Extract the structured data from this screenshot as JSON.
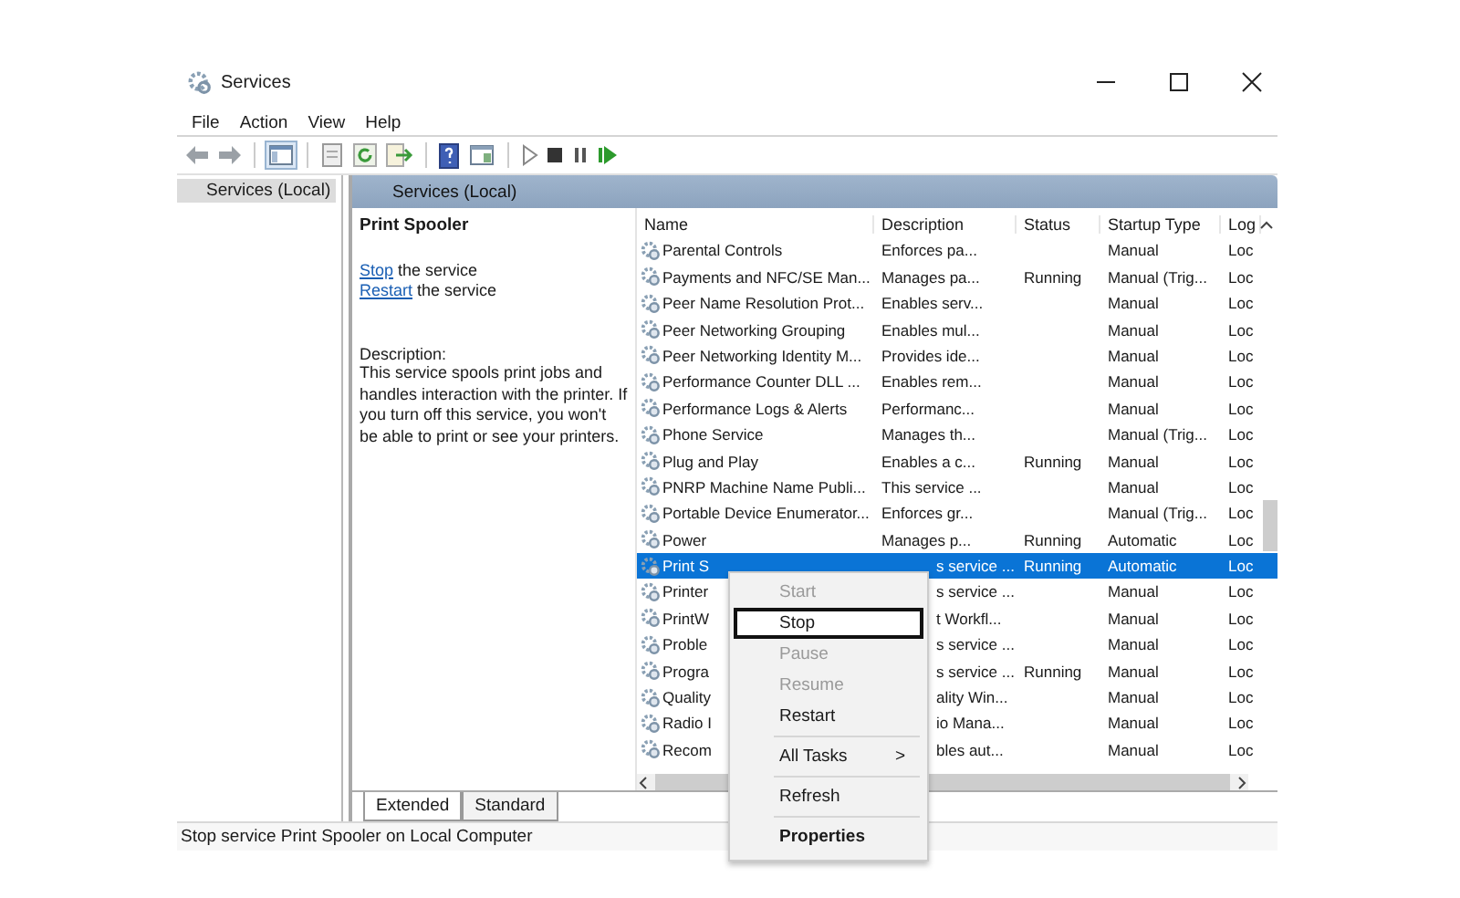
{
  "window": {
    "title": "Services"
  },
  "menu_bar": [
    "File",
    "Action",
    "View",
    "Help"
  ],
  "tree": {
    "items": [
      {
        "label": "Services (Local)",
        "selected": true
      }
    ]
  },
  "header": {
    "title": "Services (Local)"
  },
  "details": {
    "title": "Print Spooler",
    "actions": [
      {
        "link": "Stop",
        "text": "the service"
      },
      {
        "link": "Restart",
        "text": "the service"
      }
    ],
    "description_label": "Description:",
    "description": "This service spools print jobs and handles interaction with the printer. If you turn off this service, you won't be able to print or see your printers."
  },
  "table": {
    "columns": [
      "Name",
      "Description",
      "Status",
      "Startup Type",
      "Log"
    ],
    "rows": [
      {
        "kind": "full",
        "name": "Parental Controls",
        "description": "Enforces pa...",
        "startup_type": "Manual",
        "log_on_as": "Loc",
        "selected": false
      },
      {
        "kind": "full",
        "name": "Payments and NFC/SE Man...",
        "description": "Manages pa...",
        "status": "Running",
        "startup_type": "Manual (Trig...",
        "log_on_as": "Loc",
        "selected": false
      },
      {
        "kind": "full",
        "name": "Peer Name Resolution Prot...",
        "description": "Enables serv...",
        "startup_type": "Manual",
        "log_on_as": "Loc",
        "selected": false
      },
      {
        "kind": "full",
        "name": "Peer Networking Grouping",
        "description": "Enables mul...",
        "startup_type": "Manual",
        "log_on_as": "Loc",
        "selected": false
      },
      {
        "kind": "full",
        "name": "Peer Networking Identity M...",
        "description": "Provides ide...",
        "startup_type": "Manual",
        "log_on_as": "Loc",
        "selected": false
      },
      {
        "kind": "full",
        "name": "Performance Counter DLL ...",
        "description": "Enables rem...",
        "startup_type": "Manual",
        "log_on_as": "Loc",
        "selected": false
      },
      {
        "kind": "full",
        "name": "Performance Logs & Alerts",
        "description": "Performanc...",
        "startup_type": "Manual",
        "log_on_as": "Loc",
        "selected": false
      },
      {
        "kind": "full",
        "name": "Phone Service",
        "description": "Manages th...",
        "startup_type": "Manual (Trig...",
        "log_on_as": "Loc",
        "selected": false
      },
      {
        "kind": "full",
        "name": "Plug and Play",
        "description": "Enables a c...",
        "status": "Running",
        "startup_type": "Manual",
        "log_on_as": "Loc",
        "selected": false
      },
      {
        "kind": "full",
        "name": "PNRP Machine Name Publi...",
        "description": "This service ...",
        "startup_type": "Manual",
        "log_on_as": "Loc",
        "selected": false
      },
      {
        "kind": "full",
        "name": "Portable Device Enumerator...",
        "description": "Enforces gr...",
        "startup_type": "Manual (Trig...",
        "log_on_as": "Loc",
        "selected": false
      },
      {
        "kind": "full",
        "name": "Power",
        "description": "Manages p...",
        "status": "Running",
        "startup_type": "Automatic",
        "log_on_as": "Loc",
        "selected": false
      },
      {
        "kind": "covered",
        "name": "Print S",
        "description": "s service ...",
        "status": "Running",
        "startup_type": "Automatic",
        "log_on_as": "Loc",
        "selected": true
      },
      {
        "kind": "covered",
        "name": "Printer",
        "description": "s service ...",
        "startup_type": "Manual",
        "log_on_as": "Loc",
        "selected": false
      },
      {
        "kind": "covered",
        "name": "PrintW",
        "description": "t Workfl...",
        "startup_type": "Manual",
        "log_on_as": "Loc",
        "selected": false
      },
      {
        "kind": "covered",
        "name": "Proble",
        "description": "s service ...",
        "startup_type": "Manual",
        "log_on_as": "Loc",
        "selected": false
      },
      {
        "kind": "covered",
        "name": "Progra",
        "description": "s service ...",
        "status": "Running",
        "startup_type": "Manual",
        "log_on_as": "Loc",
        "selected": false
      },
      {
        "kind": "covered",
        "name": "Quality",
        "description": "ality Win...",
        "startup_type": "Manual",
        "log_on_as": "Loc",
        "selected": false
      },
      {
        "kind": "covered",
        "name": "Radio I",
        "description": "io Mana...",
        "startup_type": "Manual",
        "log_on_as": "Loc",
        "selected": false
      },
      {
        "kind": "covered",
        "name": "Recom",
        "description": "bles aut...",
        "startup_type": "Manual",
        "log_on_as": "Loc",
        "selected": false
      }
    ]
  },
  "view_tabs": [
    {
      "label": "Extended",
      "selected": true
    },
    {
      "label": "Standard",
      "selected": false
    }
  ],
  "context_menu": [
    {
      "kind": "item",
      "label": "Start",
      "disabled": true,
      "highlighted": false
    },
    {
      "kind": "item",
      "label": "Stop",
      "disabled": false,
      "highlighted": true
    },
    {
      "kind": "item",
      "label": "Pause",
      "disabled": true,
      "highlighted": false
    },
    {
      "kind": "item",
      "label": "Resume",
      "disabled": true,
      "highlighted": false
    },
    {
      "kind": "item",
      "label": "Restart",
      "disabled": false,
      "highlighted": false
    },
    {
      "kind": "separator"
    },
    {
      "kind": "submenu",
      "label": "All Tasks",
      "arrow": ">",
      "disabled": false,
      "highlighted": false
    },
    {
      "kind": "separator"
    },
    {
      "kind": "item",
      "label": "Refresh",
      "disabled": false,
      "highlighted": false
    },
    {
      "kind": "separator"
    },
    {
      "kind": "default",
      "label": "Properties",
      "disabled": false,
      "highlighted": false
    }
  ],
  "status_bar": "Stop service Print Spooler on Local Computer"
}
